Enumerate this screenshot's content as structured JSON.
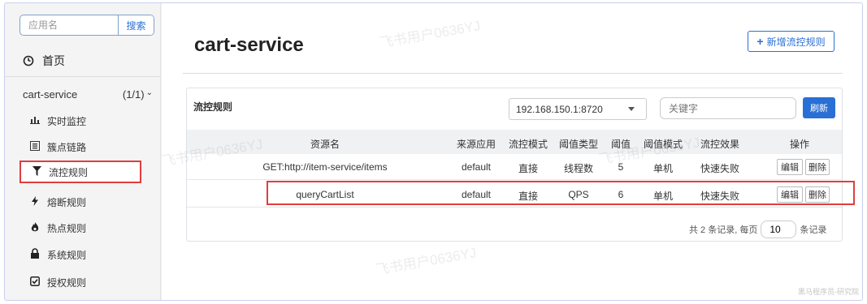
{
  "sidebar": {
    "search_placeholder": "应用名",
    "search_button": "搜索",
    "home_label": "首页",
    "app_name": "cart-service",
    "app_count": "(1/1)",
    "items": [
      {
        "label": "实时监控",
        "icon": "bar-chart-icon"
      },
      {
        "label": "簇点链路",
        "icon": "list-icon"
      },
      {
        "label": "流控规则",
        "icon": "filter-icon"
      },
      {
        "label": "熔断规则",
        "icon": "bolt-icon"
      },
      {
        "label": "热点规则",
        "icon": "fire-icon"
      },
      {
        "label": "系统规则",
        "icon": "lock-icon"
      },
      {
        "label": "授权规则",
        "icon": "check-square-icon"
      }
    ]
  },
  "main": {
    "title": "cart-service",
    "add_button": "新增流控规则"
  },
  "panel": {
    "title": "流控规则",
    "machine": "192.168.150.1:8720",
    "keyword_placeholder": "关键字",
    "refresh": "刷新",
    "columns": [
      "资源名",
      "来源应用",
      "流控模式",
      "阈值类型",
      "阈值",
      "阈值模式",
      "流控效果",
      "操作"
    ],
    "rows": [
      {
        "resource": "GET:http://item-service/items",
        "origin": "default",
        "mode": "直接",
        "threshold_type": "线程数",
        "threshold": "5",
        "threshold_mode": "单机",
        "effect": "快速失败",
        "edit": "编辑",
        "delete": "删除"
      },
      {
        "resource": "queryCartList",
        "origin": "default",
        "mode": "直接",
        "threshold_type": "QPS",
        "threshold": "6",
        "threshold_mode": "单机",
        "effect": "快速失败",
        "edit": "编辑",
        "delete": "删除"
      }
    ],
    "pager_prefix": "共 2 条记录, 每页",
    "page_size": "10",
    "pager_suffix": "条记录"
  },
  "watermark": "飞书用户0636YJ",
  "corner_note": "黑马程序员-研究院",
  "colors": {
    "accent": "#2a6fd5",
    "highlight": "#e23d3d"
  }
}
